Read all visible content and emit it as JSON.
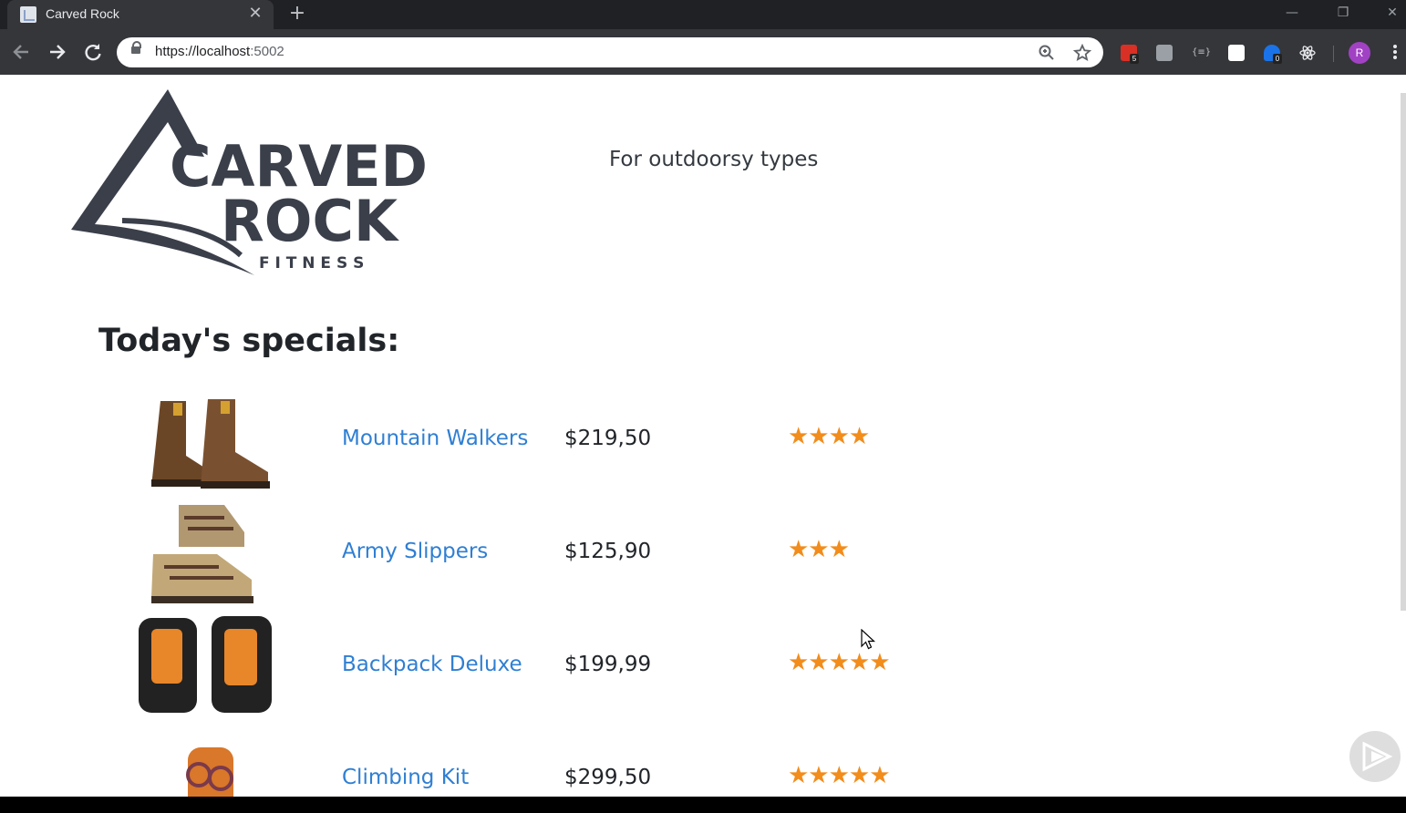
{
  "browser": {
    "tab_title": "Carved Rock",
    "url_main": "https://localhost",
    "url_port": ":5002",
    "extensions": [
      {
        "name": "calendar-extension",
        "color": "#d93025",
        "badge": "5"
      },
      {
        "name": "sigma-extension",
        "color": "#9aa0a6",
        "badge": ""
      },
      {
        "name": "json-extension",
        "color": "#35363a",
        "badge": ""
      },
      {
        "name": "white-square-extension",
        "color": "#ffffff",
        "badge": ""
      },
      {
        "name": "ghostery-extension",
        "color": "#1a73e8",
        "badge": "0"
      },
      {
        "name": "react-extension",
        "color": "#35363a",
        "badge": ""
      }
    ],
    "avatar_letter": "R"
  },
  "page": {
    "logo_text_line1": "CARVED",
    "logo_text_line2": "ROCK",
    "logo_text_line3": "F I T N E S S",
    "tagline": "For outdoorsy types",
    "specials_title": "Today's specials:",
    "products": [
      {
        "name": "Mountain Walkers",
        "price": "$219,50",
        "stars": "★★★★",
        "rating": 4,
        "image": "boots-icon"
      },
      {
        "name": "Army Slippers",
        "price": "$125,90",
        "stars": "★★★",
        "rating": 3,
        "image": "sandals-icon"
      },
      {
        "name": "Backpack Deluxe",
        "price": "$199,99",
        "stars": "★★★★★",
        "rating": 5,
        "image": "backpack-icon"
      },
      {
        "name": "Climbing Kit",
        "price": "$299,50",
        "stars": "★★★★★",
        "rating": 5,
        "image": "climbing-kit-icon"
      }
    ]
  },
  "colors": {
    "link": "#2f7fd3",
    "star": "#f28c1b",
    "logo": "#3a3f4a"
  }
}
